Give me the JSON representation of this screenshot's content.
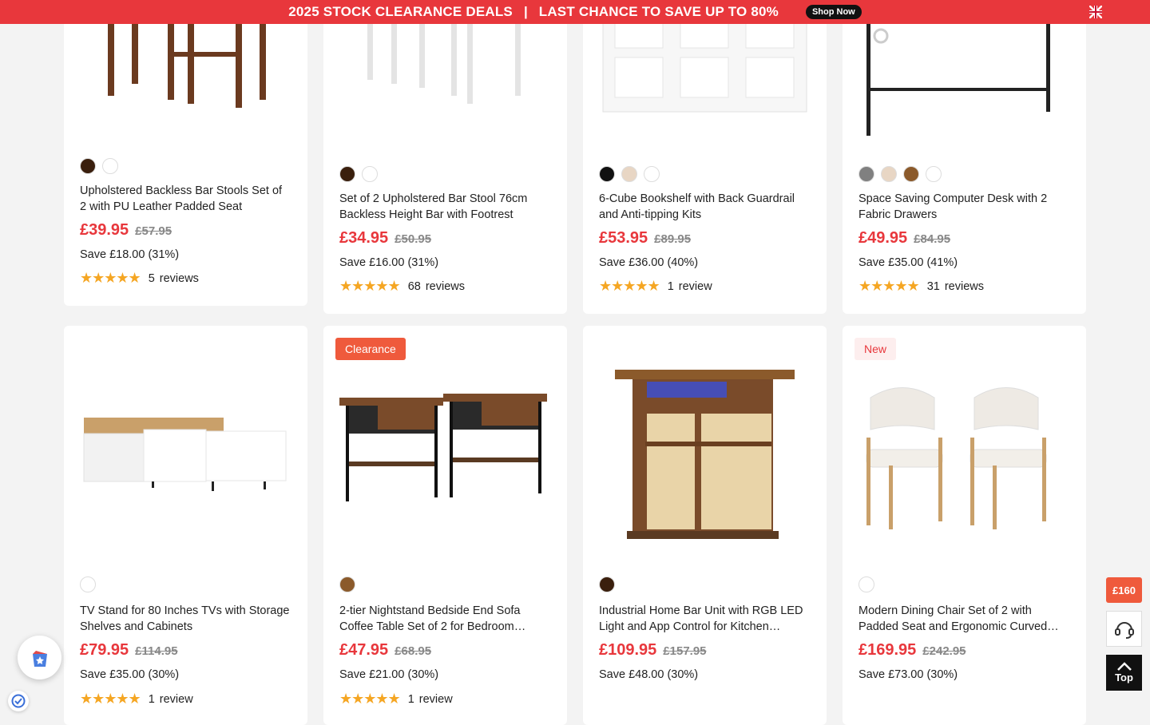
{
  "banner": {
    "text": "2025 STOCK CLEARANCE DEALS",
    "separator": "|",
    "text2": "LAST CHANCE TO SAVE UP TO 80%",
    "shop_now": "Shop Now"
  },
  "products": [
    {
      "title": "Upholstered Backless Bar Stools Set of 2 with PU Leather Padded Seat",
      "price": "£39.95",
      "old_price": "£57.95",
      "save": "Save £18.00 (31%)",
      "stars": "★★★★★",
      "review_count": "5",
      "review_word": "reviews",
      "swatches": [
        "#3a1f0d",
        "#ffffff"
      ]
    },
    {
      "title": "Set of 2 Upholstered Bar Stool 76cm Backless Height Bar with Footrest",
      "price": "£34.95",
      "old_price": "£50.95",
      "save": "Save £16.00 (31%)",
      "stars": "★★★★★",
      "review_count": "68",
      "review_word": "reviews",
      "swatches": [
        "#3a1f0d",
        "#ffffff"
      ]
    },
    {
      "title": "6-Cube Bookshelf with Back Guardrail and Anti-tipping Kits",
      "price": "£53.95",
      "old_price": "£89.95",
      "save": "Save £36.00 (40%)",
      "stars": "★★★★★",
      "review_count": "1",
      "review_word": "review",
      "swatches": [
        "#111111",
        "#e8d6c4",
        "#ffffff"
      ]
    },
    {
      "title": "Space Saving Computer Desk with 2 Fabric Drawers",
      "price": "£49.95",
      "old_price": "£84.95",
      "save": "Save £35.00 (41%)",
      "stars": "★★★★★",
      "review_count": "31",
      "review_word": "reviews",
      "swatches": [
        "#808080",
        "#e8d6c4",
        "#8b5a2b",
        "#ffffff"
      ]
    },
    {
      "title": "TV Stand for 80 Inches TVs with Storage Shelves and Cabinets",
      "price": "£79.95",
      "old_price": "£114.95",
      "save": "Save £35.00 (30%)",
      "stars": "★★★★★",
      "review_count": "1",
      "review_word": "review",
      "swatches": [
        "#ffffff"
      ],
      "badge": ""
    },
    {
      "title": "2-tier Nightstand Bedside End Sofa Coffee Table Set of 2 for Bedroom…",
      "price": "£47.95",
      "old_price": "£68.95",
      "save": "Save £21.00 (30%)",
      "stars": "★★★★★",
      "review_count": "1",
      "review_word": "review",
      "swatches": [
        "#8b5a2b"
      ],
      "badge": "Clearance"
    },
    {
      "title": "Industrial Home Bar Unit with RGB LED Light and App Control for Kitchen…",
      "price": "£109.95",
      "old_price": "£157.95",
      "save": "Save £48.00 (30%)",
      "stars": "",
      "review_count": "",
      "review_word": "",
      "swatches": [
        "#3a1f0d"
      ],
      "badge": ""
    },
    {
      "title": "Modern Dining Chair Set of 2 with Padded Seat and Ergonomic Curved…",
      "price": "£169.95",
      "old_price": "£242.95",
      "save": "Save £73.00 (30%)",
      "stars": "",
      "review_count": "",
      "review_word": "",
      "swatches": [
        "#ffffff"
      ],
      "badge": "New"
    }
  ],
  "side": {
    "coupon": "£160",
    "top": "Top"
  },
  "colors": {
    "accent": "#e8373c",
    "star": "#f5a623",
    "badge_clearance": "#ef5a3c"
  }
}
